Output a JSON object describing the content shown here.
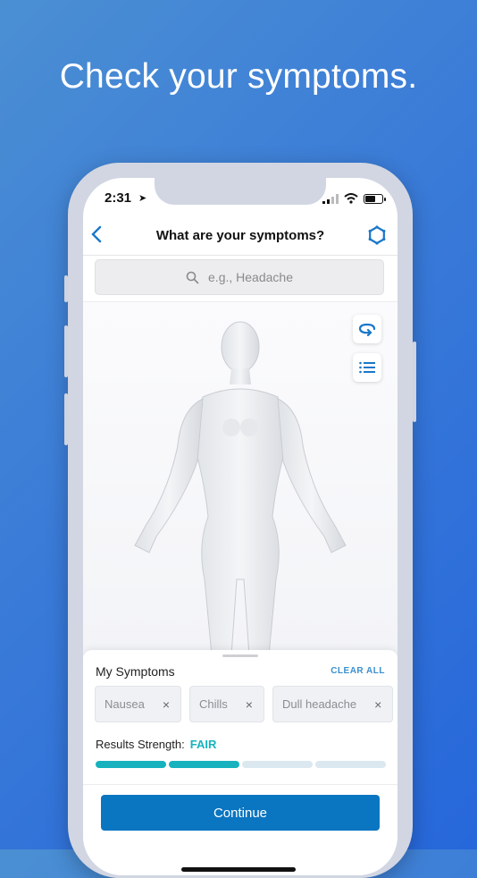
{
  "headline": "Check your symptoms.",
  "status_bar": {
    "time": "2:31",
    "location_icon": "location-arrow-icon",
    "signal_icon": "cellular-signal-icon",
    "wifi_icon": "wifi-icon",
    "battery_icon": "battery-icon"
  },
  "nav": {
    "back_icon": "chevron-left-icon",
    "title": "What are your symptoms?",
    "settings_icon": "gear-icon"
  },
  "search": {
    "placeholder": "e.g., Headache",
    "icon": "search-icon"
  },
  "viewer": {
    "rotate_icon": "rotate-icon",
    "list_icon": "list-icon",
    "model": "female-body-model"
  },
  "symptoms": {
    "heading": "My Symptoms",
    "clear_all": "CLEAR ALL",
    "items": [
      {
        "label": "Nausea",
        "remove": "×"
      },
      {
        "label": "Chills",
        "remove": "×"
      },
      {
        "label": "Dull headache",
        "remove": "×"
      }
    ]
  },
  "results_strength": {
    "label": "Results Strength:",
    "value": "FAIR",
    "filled_segments": 2,
    "total_segments": 4
  },
  "colors": {
    "accent": "#1a77c9",
    "strength": "#17b2be",
    "strength_empty": "#dbe8ef",
    "button": "#0a75c0"
  },
  "continue_label": "Continue"
}
